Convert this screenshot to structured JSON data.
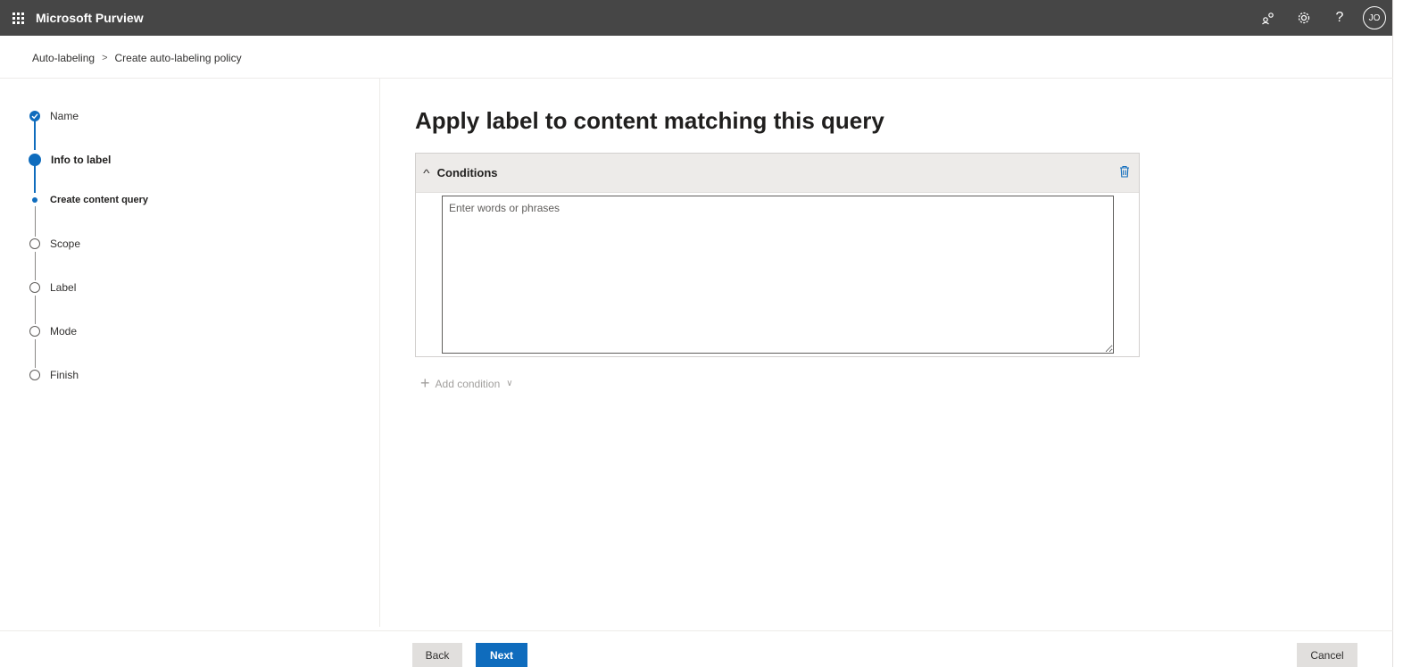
{
  "app": {
    "title": "Microsoft Purview"
  },
  "topbar": {
    "icons": [
      "community-icon",
      "gear-icon",
      "help-icon"
    ],
    "avatar_initials": "JO"
  },
  "breadcrumb": {
    "items": [
      "Auto-labeling",
      "Create auto-labeling policy"
    ]
  },
  "wizard": {
    "steps": [
      {
        "label": "Name",
        "state": "completed"
      },
      {
        "label": "Info to label",
        "state": "current"
      },
      {
        "label": "Create content query",
        "state": "current-substep"
      },
      {
        "label": "Scope",
        "state": "pending"
      },
      {
        "label": "Label",
        "state": "pending"
      },
      {
        "label": "Mode",
        "state": "pending"
      },
      {
        "label": "Finish",
        "state": "pending"
      }
    ]
  },
  "main": {
    "heading": "Apply label to content matching this query",
    "conditions": {
      "title": "Conditions",
      "query_placeholder": "Enter words or phrases",
      "query_value": ""
    },
    "add_condition_label": "Add condition"
  },
  "footer": {
    "back_label": "Back",
    "next_label": "Next",
    "cancel_label": "Cancel"
  },
  "colors": {
    "accent": "#0f6cbd",
    "topbar": "#464646"
  }
}
